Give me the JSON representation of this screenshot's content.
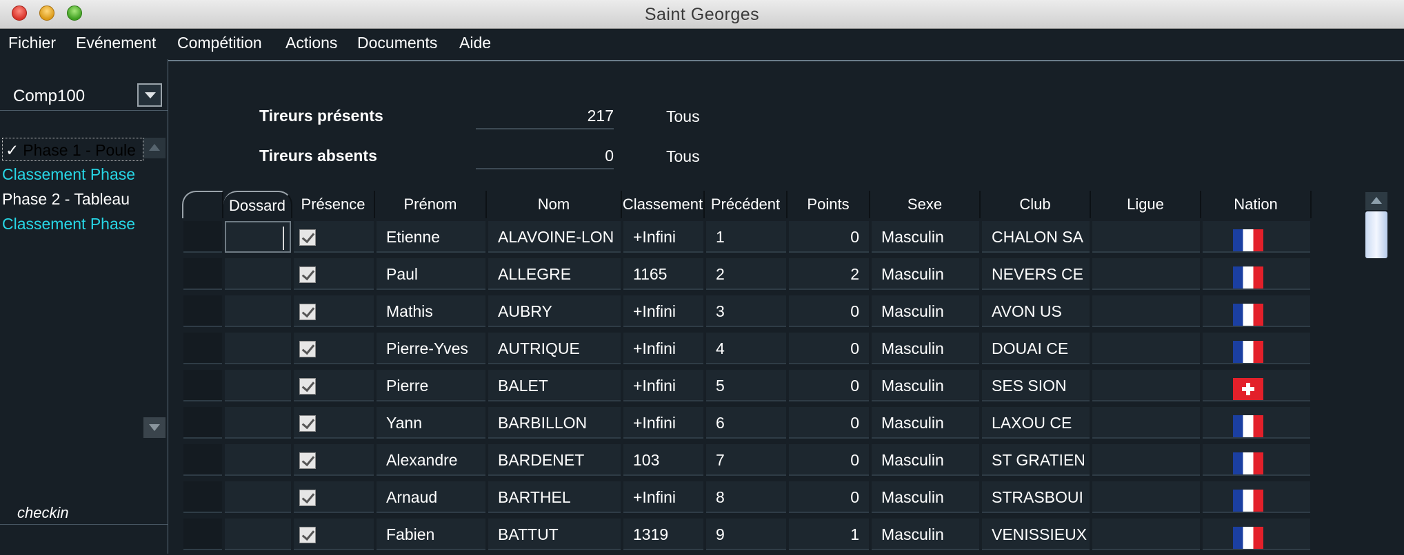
{
  "window": {
    "title": "Saint Georges"
  },
  "menu": [
    "Fichier",
    "Evénement",
    "Compétition",
    "Actions",
    "Documents",
    "Aide"
  ],
  "sidebar": {
    "competition": "Comp100",
    "phases": [
      {
        "label": "Phase 1 - Poule",
        "color": "#ffffff",
        "checked": true,
        "selected": true
      },
      {
        "label": "Classement Phase",
        "color": "#27d7e6",
        "checked": false,
        "selected": false
      },
      {
        "label": "Phase 2 - Tableau",
        "color": "#ffffff",
        "checked": false,
        "selected": false
      },
      {
        "label": "Classement Phase",
        "color": "#27d7e6",
        "checked": false,
        "selected": false
      }
    ],
    "footer_label": "checkin"
  },
  "stats": {
    "present_label": "Tireurs présents",
    "present_value": "217",
    "present_filter": "Tous",
    "absent_label": "Tireurs absents",
    "absent_value": "0",
    "absent_filter": "Tous"
  },
  "table": {
    "columns": [
      "",
      "Dossard",
      "Présence",
      "Prénom",
      "Nom",
      "Classement",
      "Précédent",
      "Points",
      "Sexe",
      "Club",
      "Ligue",
      "Nation"
    ],
    "rows": [
      {
        "dossard": "",
        "presence": true,
        "prenom": "Etienne",
        "nom": "ALAVOINE-LON",
        "classement": "+Infini",
        "precedent": "1",
        "points": "0",
        "sexe": "Masculin",
        "club": "CHALON SA",
        "ligue": "",
        "nation": "fr"
      },
      {
        "dossard": "",
        "presence": true,
        "prenom": "Paul",
        "nom": "ALLEGRE",
        "classement": "1165",
        "precedent": "2",
        "points": "2",
        "sexe": "Masculin",
        "club": "NEVERS CE",
        "ligue": "",
        "nation": "fr"
      },
      {
        "dossard": "",
        "presence": true,
        "prenom": "Mathis",
        "nom": "AUBRY",
        "classement": "+Infini",
        "precedent": "3",
        "points": "0",
        "sexe": "Masculin",
        "club": "AVON US",
        "ligue": "",
        "nation": "fr"
      },
      {
        "dossard": "",
        "presence": true,
        "prenom": "Pierre-Yves",
        "nom": "AUTRIQUE",
        "classement": "+Infini",
        "precedent": "4",
        "points": "0",
        "sexe": "Masculin",
        "club": "DOUAI CE",
        "ligue": "",
        "nation": "fr"
      },
      {
        "dossard": "",
        "presence": true,
        "prenom": "Pierre",
        "nom": "BALET",
        "classement": "+Infini",
        "precedent": "5",
        "points": "0",
        "sexe": "Masculin",
        "club": "SES SION",
        "ligue": "",
        "nation": "ch"
      },
      {
        "dossard": "",
        "presence": true,
        "prenom": "Yann",
        "nom": "BARBILLON",
        "classement": "+Infini",
        "precedent": "6",
        "points": "0",
        "sexe": "Masculin",
        "club": "LAXOU CE",
        "ligue": "",
        "nation": "fr"
      },
      {
        "dossard": "",
        "presence": true,
        "prenom": "Alexandre",
        "nom": "BARDENET",
        "classement": "103",
        "precedent": "7",
        "points": "0",
        "sexe": "Masculin",
        "club": "ST GRATIEN",
        "ligue": "",
        "nation": "fr"
      },
      {
        "dossard": "",
        "presence": true,
        "prenom": "Arnaud",
        "nom": "BARTHEL",
        "classement": "+Infini",
        "precedent": "8",
        "points": "0",
        "sexe": "Masculin",
        "club": "STRASBOUI",
        "ligue": "",
        "nation": "fr"
      },
      {
        "dossard": "",
        "presence": true,
        "prenom": "Fabien",
        "nom": "BATTUT",
        "classement": "1319",
        "precedent": "9",
        "points": "1",
        "sexe": "Masculin",
        "club": "VENISSIEUX",
        "ligue": "",
        "nation": "fr"
      }
    ]
  }
}
